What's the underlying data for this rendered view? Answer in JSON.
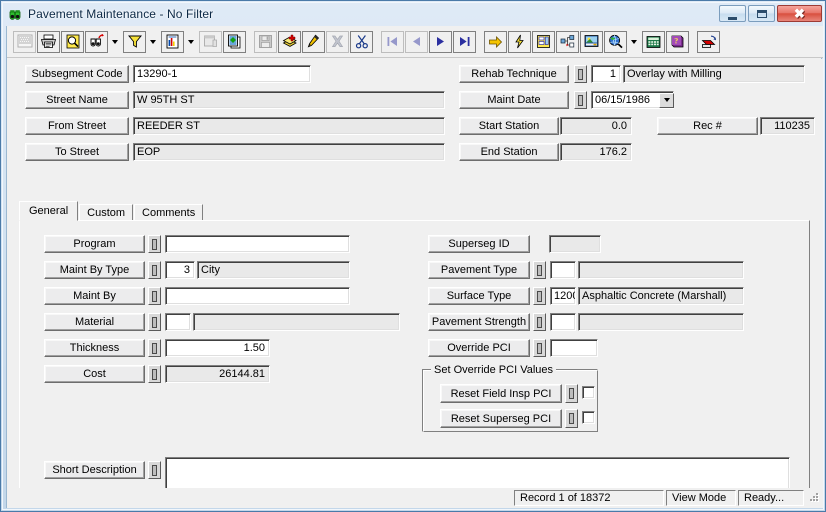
{
  "window": {
    "title": "Pavement Maintenance - No Filter",
    "app_icon": "binoculars-icon",
    "minimize_label": "–",
    "maximize_label": "□",
    "close_label": "✕"
  },
  "toolbar": {
    "buttons": [
      {
        "name": "grid-view-button",
        "icon": "grid-icon",
        "disabled": true,
        "framed": true
      },
      {
        "name": "print-button",
        "icon": "printer-icon",
        "disabled": false,
        "framed": true
      },
      {
        "name": "print-preview-button",
        "icon": "magnifier-page-icon",
        "disabled": false,
        "framed": true
      },
      {
        "name": "find-button",
        "icon": "binoculars-icon",
        "disabled": false,
        "framed": true
      },
      {
        "name": "find-dropdown",
        "icon": "chevron-down-icon",
        "dropdown": true
      },
      {
        "name": "filter-button",
        "icon": "funnel-icon",
        "disabled": false,
        "framed": true
      },
      {
        "name": "filter-dropdown",
        "icon": "chevron-down-icon",
        "dropdown": true
      },
      {
        "name": "report-button",
        "icon": "report-page-icon",
        "disabled": false,
        "framed": true
      },
      {
        "name": "report-dropdown",
        "icon": "chevron-down-icon",
        "dropdown": true
      },
      {
        "name": "properties-button",
        "icon": "window-properties-icon",
        "disabled": true,
        "framed": true
      },
      {
        "name": "copy-record-button",
        "icon": "copy-pages-icon",
        "disabled": false,
        "framed": true
      },
      {
        "name": "separator-1",
        "icon": "separator"
      },
      {
        "name": "save-button",
        "icon": "floppy-disk-icon",
        "disabled": true,
        "framed": true
      },
      {
        "name": "add-record-button",
        "icon": "add-stack-icon",
        "disabled": false,
        "framed": true
      },
      {
        "name": "edit-record-button",
        "icon": "pencil-icon",
        "disabled": false,
        "framed": true
      },
      {
        "name": "delete-record-button",
        "icon": "x-mark-icon",
        "disabled": true,
        "framed": true
      },
      {
        "name": "cut-button",
        "icon": "scissors-icon",
        "disabled": false,
        "framed": true
      },
      {
        "name": "separator-2",
        "icon": "separator"
      },
      {
        "name": "first-record-button",
        "icon": "first-record-icon",
        "disabled": true,
        "framed": true
      },
      {
        "name": "previous-record-button",
        "icon": "previous-record-icon",
        "disabled": true,
        "framed": true
      },
      {
        "name": "next-record-button",
        "icon": "next-record-icon",
        "disabled": false,
        "framed": true
      },
      {
        "name": "last-record-button",
        "icon": "last-record-icon",
        "disabled": false,
        "framed": true
      },
      {
        "name": "separator-3",
        "icon": "separator"
      },
      {
        "name": "goto-button",
        "icon": "yellow-arrow-icon",
        "disabled": false,
        "framed": true
      },
      {
        "name": "quick-action-button",
        "icon": "lightning-bolt-icon",
        "disabled": false,
        "framed": true
      },
      {
        "name": "layout-button",
        "icon": "form-layout-icon",
        "disabled": false,
        "framed": true
      },
      {
        "name": "tree-view-button",
        "icon": "tree-hierarchy-icon",
        "disabled": false,
        "framed": true
      },
      {
        "name": "image-viewer-button",
        "icon": "picture-icon",
        "disabled": false,
        "framed": true
      },
      {
        "name": "map-button",
        "icon": "globe-magnifier-icon",
        "disabled": false,
        "framed": true
      },
      {
        "name": "map-dropdown",
        "icon": "chevron-down-icon",
        "dropdown": true
      },
      {
        "name": "calculator-button",
        "icon": "calculator-icon",
        "disabled": false,
        "framed": true
      },
      {
        "name": "help-button",
        "icon": "help-book-icon",
        "disabled": false,
        "framed": true
      },
      {
        "name": "separator-4",
        "icon": "separator"
      },
      {
        "name": "exit-button",
        "icon": "exit-door-icon",
        "disabled": false,
        "framed": true
      }
    ]
  },
  "header": {
    "left_fields": [
      {
        "label": "Subsegment Code",
        "value": "13290-1",
        "readonly": false
      },
      {
        "label": "Street Name",
        "value": "W 95TH ST",
        "readonly": true
      },
      {
        "label": "From Street",
        "value": "REEDER ST",
        "readonly": true
      },
      {
        "label": "To Street",
        "value": "EOP",
        "readonly": true
      }
    ],
    "rehab_technique": {
      "label": "Rehab Technique",
      "code": "1",
      "description": "Overlay with Milling"
    },
    "maint_date": {
      "label": "Maint Date",
      "value": "06/15/1986"
    },
    "start_station": {
      "label": "Start Station",
      "value": "0.0"
    },
    "end_station": {
      "label": "End Station",
      "value": "176.2"
    },
    "rec_number": {
      "label": "Rec #",
      "value": "110235"
    }
  },
  "tabs": [
    {
      "label": "General",
      "active": true
    },
    {
      "label": "Custom",
      "active": false
    },
    {
      "label": "Comments",
      "active": false
    }
  ],
  "general_tab": {
    "left_fields": [
      {
        "label": "Program",
        "code": "",
        "description": null,
        "has_spin": true,
        "numeric_value": null
      },
      {
        "label": "Maint By Type",
        "code": "3",
        "description": "City",
        "has_spin": true
      },
      {
        "label": "Maint By",
        "code": "",
        "description": null,
        "has_spin": true
      },
      {
        "label": "Material",
        "code": "",
        "description": "",
        "has_spin": true
      },
      {
        "label": "Thickness",
        "numeric_value": "1.50",
        "has_spin": true
      },
      {
        "label": "Cost",
        "numeric_value": "26144.81",
        "has_spin": true
      }
    ],
    "right_fields": [
      {
        "label": "Superseg ID",
        "value": "",
        "has_spin": false,
        "readonly": true
      },
      {
        "label": "Pavement Type",
        "code": "",
        "description": "",
        "has_spin": true
      },
      {
        "label": "Surface Type",
        "code": "1200",
        "description": "Asphaltic Concrete (Marshall)",
        "has_spin": true
      },
      {
        "label": "Pavement Strength",
        "code": "",
        "description": "",
        "has_spin": true
      },
      {
        "label": "Override PCI",
        "code": "",
        "description": null,
        "has_spin": true
      }
    ],
    "override_group": {
      "title": "Set Override PCI Values",
      "rows": [
        {
          "label": "Reset Field Insp PCI",
          "checked": false
        },
        {
          "label": "Reset Superseg PCI",
          "checked": false
        }
      ]
    },
    "short_description": {
      "label": "Short Description",
      "value": ""
    }
  },
  "statusbar": {
    "record_info": "Record 1 of 18372",
    "mode": "View Mode",
    "state": "Ready..."
  },
  "colors": {
    "window_face": "#f0f0f0",
    "field_bg": "#ffffff",
    "readonly_bg": "#e9e9e9",
    "title_text": "#0b2845",
    "close_button": "#d9503f"
  }
}
